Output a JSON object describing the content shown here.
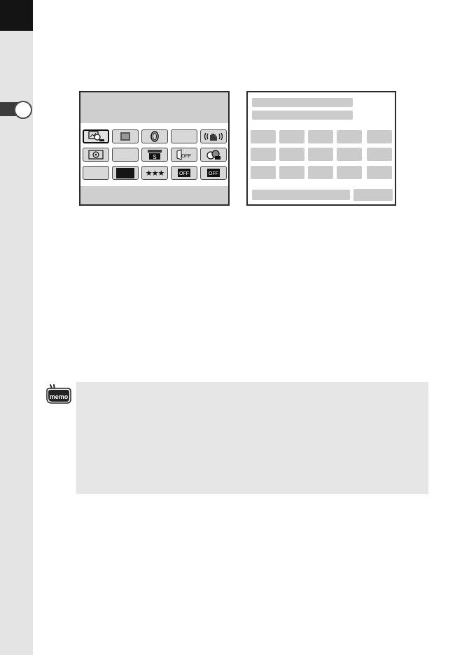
{
  "side_tab": {
    "label": ""
  },
  "control_panel": {
    "rows": [
      [
        {
          "icon": "scene-mode-icon",
          "label": "",
          "selected": true
        },
        {
          "icon": "film-strip-icon",
          "label": ""
        },
        {
          "icon": "lens-ring-icon",
          "label": ""
        },
        {
          "icon": "blank-icon",
          "label": ""
        },
        {
          "icon": "shake-reduction-icon",
          "label": ""
        }
      ],
      [
        {
          "icon": "metering-icon",
          "label": ""
        },
        {
          "icon": "blank-icon",
          "label": ""
        },
        {
          "icon": "drive-mode-icon",
          "label": "S"
        },
        {
          "icon": "dr-off-icon",
          "label": "OFF"
        },
        {
          "icon": "hdr-icon",
          "label": ""
        }
      ],
      [
        {
          "icon": "blank-icon",
          "label": ""
        },
        {
          "icon": "black-swatch-icon",
          "label": ""
        },
        {
          "icon": "quality-stars-icon",
          "label": "★★★"
        },
        {
          "icon": "noise-off-icon",
          "label": "OFF"
        },
        {
          "icon": "noise-off-icon",
          "label": "OFF"
        }
      ]
    ]
  },
  "memo": {
    "icon": "memo-icon",
    "icon_text": "memo",
    "text": ""
  }
}
